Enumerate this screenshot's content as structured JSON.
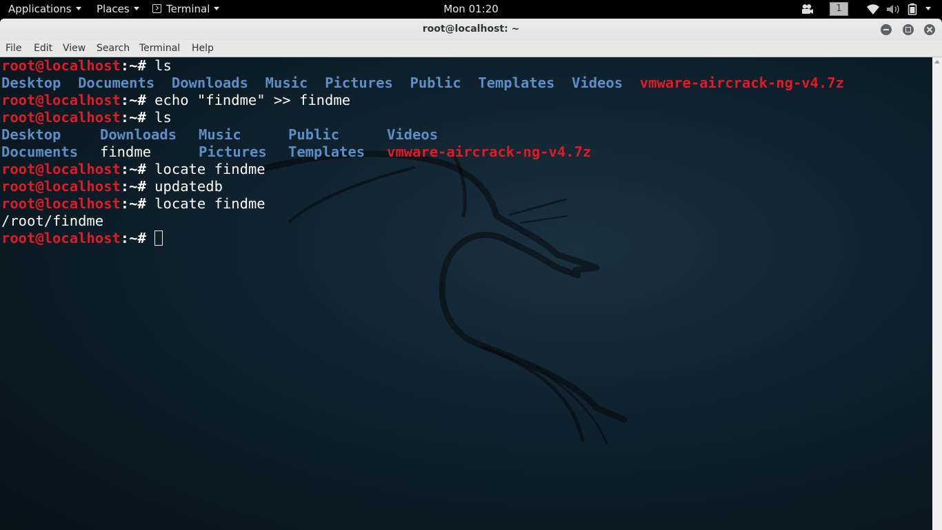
{
  "topbar": {
    "applications": "Applications",
    "places": "Places",
    "terminal": "Terminal",
    "clock": "Mon 01:20",
    "workspace": "1"
  },
  "window": {
    "title": "root@localhost: ~",
    "menu": [
      "File",
      "Edit",
      "View",
      "Search",
      "Terminal",
      "Help"
    ]
  },
  "terminal": {
    "prompt_user": "root@localhost",
    "prompt_sep": ":~# ",
    "lines": [
      {
        "type": "prompt",
        "cmd": "ls"
      },
      {
        "type": "output",
        "items": [
          {
            "text": "Desktop",
            "style": "dir"
          },
          {
            "text": "Documents",
            "style": "dir"
          },
          {
            "text": "Downloads",
            "style": "dir"
          },
          {
            "text": "Music",
            "style": "dir"
          },
          {
            "text": "Pictures",
            "style": "dir"
          },
          {
            "text": "Public",
            "style": "dir"
          },
          {
            "text": "Templates",
            "style": "dir"
          },
          {
            "text": "Videos",
            "style": "dir"
          },
          {
            "text": "vmware-aircrack-ng-v4.7z",
            "style": "arc"
          }
        ]
      },
      {
        "type": "prompt",
        "cmd": "echo \"findme\" >> findme"
      },
      {
        "type": "prompt",
        "cmd": "ls"
      },
      {
        "type": "output",
        "items": [
          {
            "text": "Desktop",
            "style": "dir"
          },
          {
            "text": "Downloads",
            "style": "dir"
          },
          {
            "text": "Music",
            "style": "dir"
          },
          {
            "text": "Public",
            "style": "dir"
          },
          {
            "text": "Videos",
            "style": "dir"
          }
        ]
      },
      {
        "type": "output",
        "items": [
          {
            "text": "Documents",
            "style": "dir"
          },
          {
            "text": "findme",
            "style": "txt"
          },
          {
            "text": "Pictures",
            "style": "dir"
          },
          {
            "text": "Templates",
            "style": "dir"
          },
          {
            "text": "vmware-aircrack-ng-v4.7z",
            "style": "arc"
          }
        ]
      },
      {
        "type": "prompt",
        "cmd": "locate findme"
      },
      {
        "type": "prompt",
        "cmd": "updatedb"
      },
      {
        "type": "prompt",
        "cmd": "locate findme"
      },
      {
        "type": "output",
        "items": [
          {
            "text": "/root/findme",
            "style": "txt"
          }
        ]
      },
      {
        "type": "prompt",
        "cmd": "",
        "cursor": true
      }
    ]
  },
  "colors": {
    "prompt_red": "#e01b24",
    "dir_blue": "#5c8ec8",
    "terminal_bg": "#0f222e"
  },
  "icons": [
    "terminal-icon",
    "camera-icon",
    "wifi-icon",
    "volume-icon",
    "battery-icon",
    "minimize-icon",
    "maximize-icon",
    "close-icon"
  ]
}
